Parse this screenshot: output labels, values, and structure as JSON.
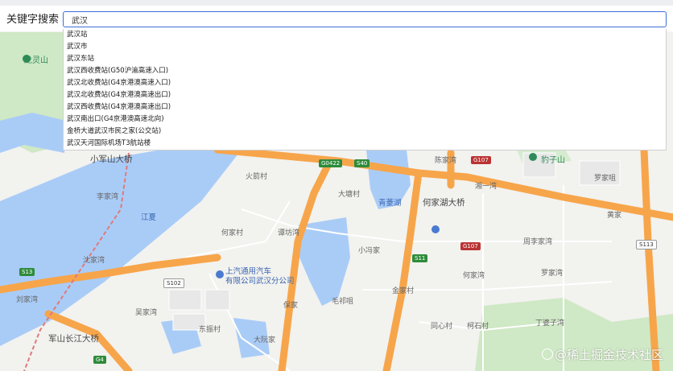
{
  "search": {
    "label": "关键字搜索",
    "value": "武汉",
    "suggestions": [
      "武汉站",
      "武汉市",
      "武汉东站",
      "武汉西收费站(G50沪渝高速入口)",
      "武汉北收费站(G4京港澳高速入口)",
      "武汉北收费站(G4京港澳高速出口)",
      "武汉西收费站(G4京港澳高速出口)",
      "武汉南出口(G4京港澳高速北向)",
      "金桥大道武汉市民之家(公交站)",
      "武汉天河国际机场T3航站楼"
    ]
  },
  "map": {
    "labels": {
      "longlingshan": "龙灵山",
      "xiaojunshan_bridge": "小军山大桥",
      "huojiacun": "火箭村",
      "dabeicun": "大塘村",
      "qingling_lake": "青菱湖",
      "hejiahu_bridge": "何家湖大桥",
      "jiangxiang": "江夏",
      "lijiawan": "李家湾",
      "hejiacun": "何家村",
      "tanfangwan": "谭坊湾",
      "xiaoduanjia": "小冯家",
      "shenjiawan": "沈家湾",
      "saic": "上汽通用汽车\n有限公司武汉分公司",
      "liujiawan": "刘家湾",
      "hongtudi": "毛祁咀",
      "huangjiawan": "吴家湾",
      "dongzhencun": "东振村",
      "junshan_bridge": "军山长江大桥",
      "daruanjia": "大阮家",
      "tongxincun": "同心村",
      "kexin": "柯石村",
      "zhoulijiawan": "周李家湾",
      "hejiawan": "何家湾",
      "luojiawan": "罗家湾",
      "dingjiawan": "丁婆子湾",
      "bao": "豹子山",
      "luojiazui": "罗家咀",
      "xiangyi": "湘一湾",
      "chengxiang": "陈家湾",
      "dongjia": "金家村",
      "baoshan": "保家",
      "huanggang": "黄家"
    },
    "shields": {
      "g0422": "G0422",
      "s40": "S40",
      "g107a": "G107",
      "g107b": "G107",
      "s11": "S11",
      "s113": "S113",
      "s13": "S13",
      "s102": "S102",
      "g4": "G4"
    }
  },
  "watermark": "@稀土掘金技术社区"
}
